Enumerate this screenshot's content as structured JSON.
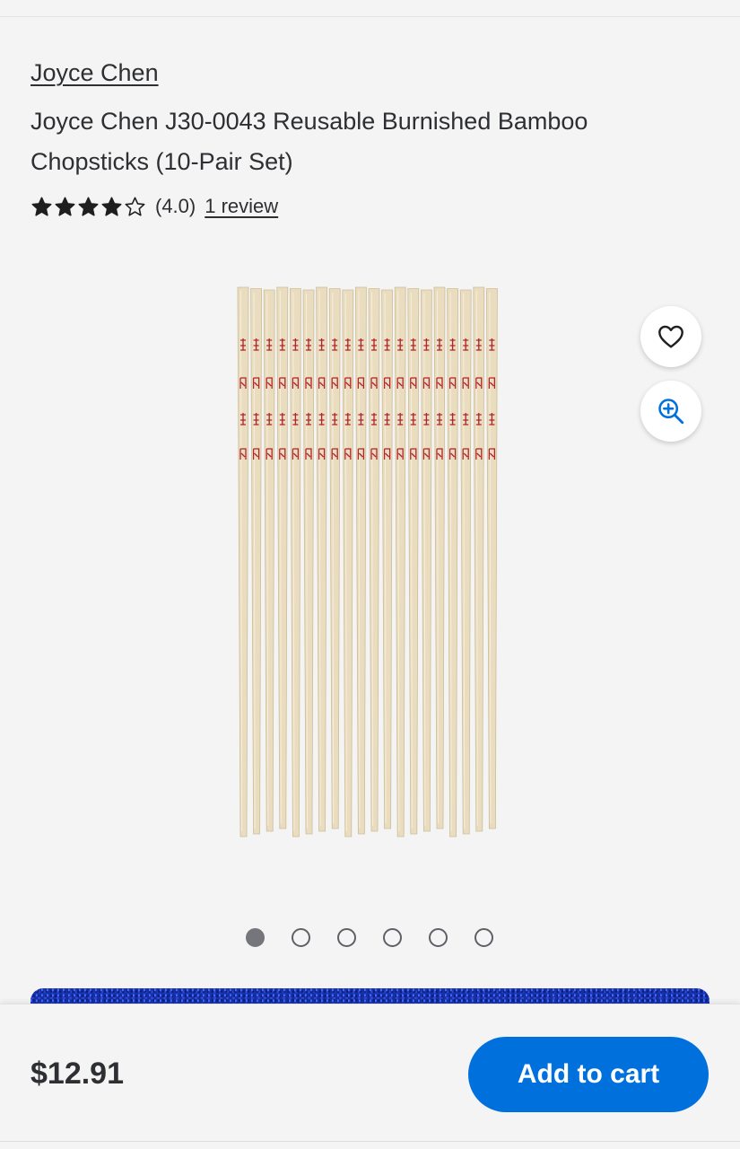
{
  "product": {
    "brand": "Joyce Chen",
    "title": "Joyce Chen J30-0043 Reusable Burnished Bamboo Chopsticks (10-Pair Set)",
    "rating": {
      "value_text": "(4.0)",
      "stars": 4,
      "max_stars": 5,
      "reviews_text": "1 review"
    },
    "image": {
      "description_icon": "chopsticks-image",
      "wood_color": "#e9dcbf",
      "print_color": "#b2232a"
    },
    "carousel": {
      "total": 6,
      "active_index": 0
    }
  },
  "actions": {
    "favorite_icon": "heart-icon",
    "zoom_icon": "zoom-in-icon"
  },
  "footer": {
    "price": "$12.91",
    "add_to_cart_label": "Add to cart"
  },
  "colors": {
    "accent": "#0071dc",
    "banner": "#1631a8",
    "background": "#f4f4f5"
  }
}
